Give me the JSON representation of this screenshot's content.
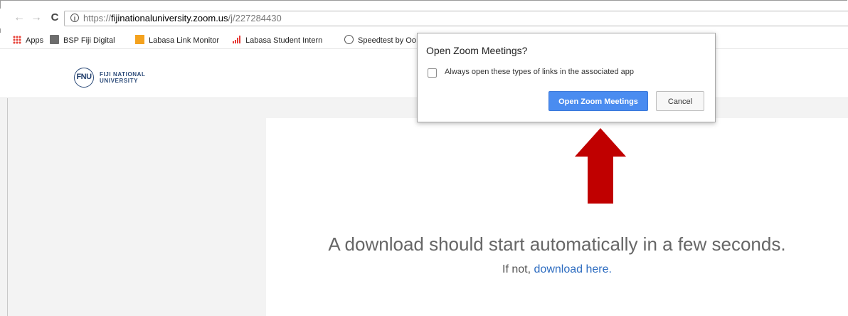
{
  "browser": {
    "url_scheme": "https://",
    "url_host": "fijinationaluniversity.zoom.us",
    "url_path": "/j/227284430",
    "nav_icons": [
      "back-arrow-icon",
      "forward-arrow-icon",
      "reload-icon",
      "info-icon"
    ]
  },
  "bookmarks": {
    "items": [
      {
        "label": "Apps",
        "icon": "apps-grid-icon"
      },
      {
        "label": "BSP Fiji Digital",
        "icon": "bsp-icon"
      },
      {
        "label": "Labasa Link Monitor",
        "icon": "labasa-icon"
      },
      {
        "label": "Labasa Student Intern",
        "icon": "bar-chart-icon"
      },
      {
        "label": "Speedtest by Oo",
        "icon": "speedometer-icon"
      }
    ]
  },
  "site": {
    "logo_mark": "FNU",
    "logo_line1": "FIJI NATIONAL",
    "logo_line2": "UNIVERSITY"
  },
  "main": {
    "headline": "A download should start automatically in a few seconds.",
    "sub_prefix": "If not, ",
    "sub_link": "download here."
  },
  "dialog": {
    "title": "Open Zoom Meetings?",
    "checkbox_label": "Always open these types of links in the associated app",
    "checkbox_checked": false,
    "primary_label": "Open Zoom Meetings",
    "cancel_label": "Cancel"
  },
  "colors": {
    "primary_button": "#4a8cf0",
    "arrow": "#c00000",
    "link": "#2d6cc0"
  }
}
